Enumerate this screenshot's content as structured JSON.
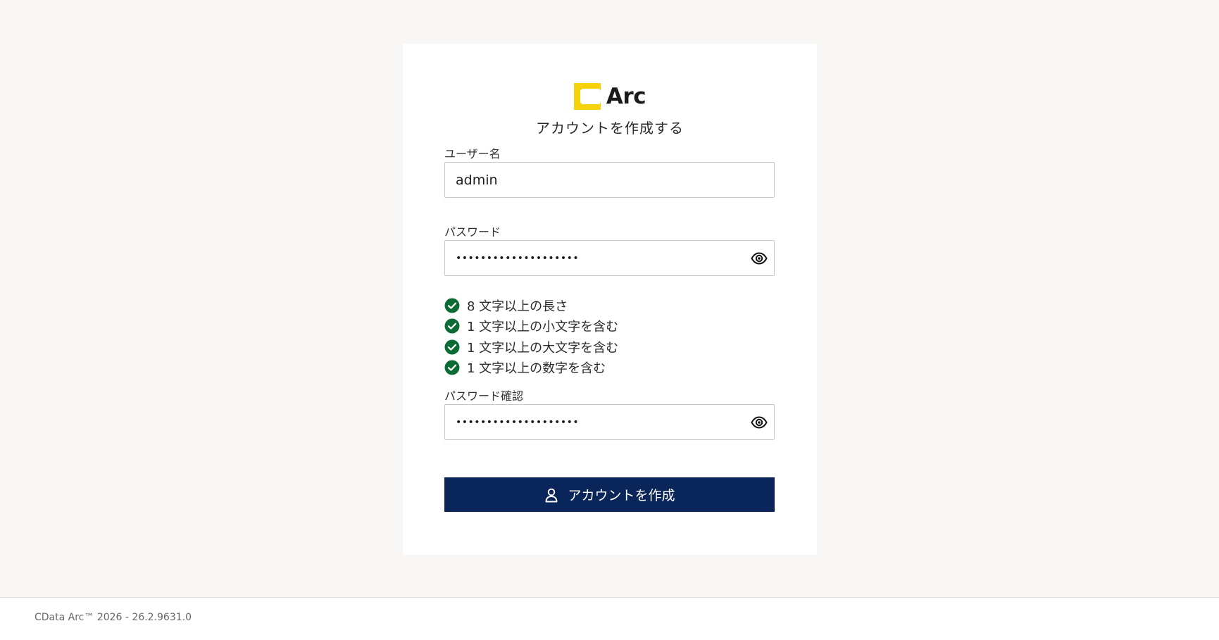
{
  "brand": {
    "name": "Arc",
    "accent_color": "#f5d20a"
  },
  "subtitle": "アカウントを作成する",
  "username": {
    "label": "ユーザー名",
    "value": "admin"
  },
  "password": {
    "label": "パスワード",
    "masked_value": "••••••••••••••••••••",
    "toggle_icon": "eye-icon"
  },
  "password_rules": [
    {
      "text": "8 文字以上の長さ",
      "satisfied": true
    },
    {
      "text": "1 文字以上の小文字を含む",
      "satisfied": true
    },
    {
      "text": "1 文字以上の大文字を含む",
      "satisfied": true
    },
    {
      "text": "1 文字以上の数字を含む",
      "satisfied": true
    }
  ],
  "confirm_password": {
    "label": "パスワード確認",
    "masked_value": "••••••••••••••••••••",
    "toggle_icon": "eye-icon"
  },
  "submit": {
    "label": "アカウントを作成",
    "icon": "user-icon",
    "color": "#0a2559"
  },
  "check_color": "#0b6b34",
  "footer": {
    "text": "CData Arc™ 2026 - 26.2.9631.0"
  }
}
